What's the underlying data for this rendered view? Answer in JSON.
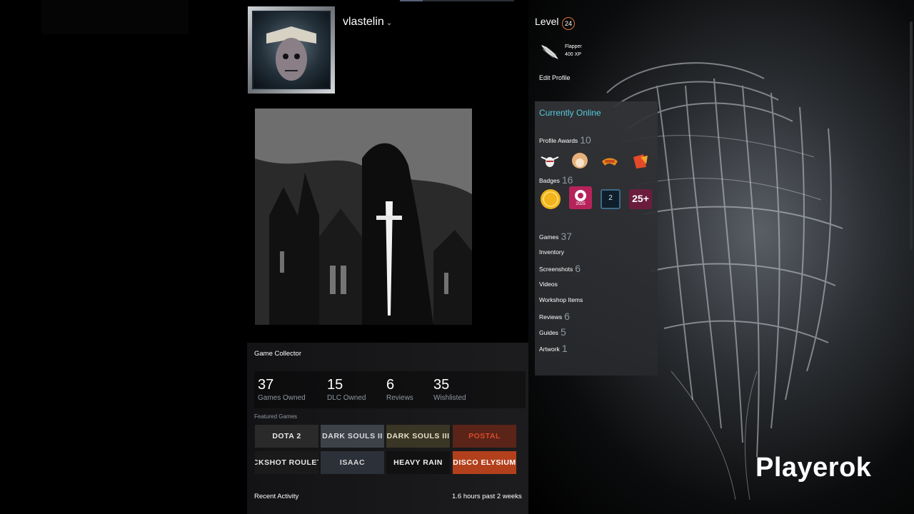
{
  "profile": {
    "persona_name": "vlastelin",
    "caret": "⌄"
  },
  "level": {
    "label": "Level",
    "value": "24"
  },
  "xp_badge": {
    "name": "Flapper",
    "xp": "400 XP",
    "icon": "wing-icon"
  },
  "edit_profile": "Edit Profile",
  "status": "Currently Online",
  "awards": {
    "label": "Profile Awards",
    "count": "10",
    "icons": [
      "bee-award-icon",
      "corgi-award-icon",
      "hotdog-award-icon",
      "trophy-award-icon"
    ]
  },
  "badges": {
    "label": "Badges",
    "count": "16",
    "items": [
      {
        "icon": "gold-coin-badge-icon"
      },
      {
        "icon": "steam-2025-badge-icon",
        "text": "2025"
      },
      {
        "icon": "number-badge-icon",
        "text": "2"
      },
      {
        "icon": "years-badge-icon",
        "text": "25+"
      }
    ]
  },
  "links": [
    {
      "label": "Games",
      "count": "37"
    },
    {
      "label": "Inventory",
      "count": ""
    },
    {
      "label": "Screenshots",
      "count": "6"
    },
    {
      "label": "Videos",
      "count": ""
    },
    {
      "label": "Workshop Items",
      "count": ""
    },
    {
      "label": "Reviews",
      "count": "6"
    },
    {
      "label": "Guides",
      "count": "5"
    },
    {
      "label": "Artwork",
      "count": "1"
    }
  ],
  "showcase": {
    "title": "Game Collector",
    "stats": [
      {
        "value": "37",
        "label": "Games Owned"
      },
      {
        "value": "15",
        "label": "DLC Owned"
      },
      {
        "value": "6",
        "label": "Reviews"
      },
      {
        "value": "35",
        "label": "Wishlisted"
      }
    ],
    "featured_label": "Featured Games",
    "games": [
      {
        "title": "DOTA 2",
        "bg": "#2a2a2a",
        "color": "#e8e8e8"
      },
      {
        "title": "DARK SOULS II",
        "bg": "#3d4148",
        "color": "#dcdcdc"
      },
      {
        "title": "DARK SOULS III",
        "bg": "#3a3626",
        "color": "#e6e0c8"
      },
      {
        "title": "POSTAL",
        "bg": "#5a2418",
        "color": "#d94a2a"
      },
      {
        "title": "BUCKSHOT ROULETTE",
        "bg": "#1a1a1a",
        "color": "#e8e8e8"
      },
      {
        "title": "ISAAC",
        "bg": "#2c3038",
        "color": "#d8d8d8"
      },
      {
        "title": "HEAVY RAIN",
        "bg": "#111111",
        "color": "#f0f0f0"
      },
      {
        "title": "DISCO ELYSIUM",
        "bg": "#b3401c",
        "color": "#ffffff"
      }
    ]
  },
  "recent_activity": {
    "label": "Recent Activity",
    "hours": "1.6 hours past 2 weeks"
  },
  "watermark": "Playerok"
}
